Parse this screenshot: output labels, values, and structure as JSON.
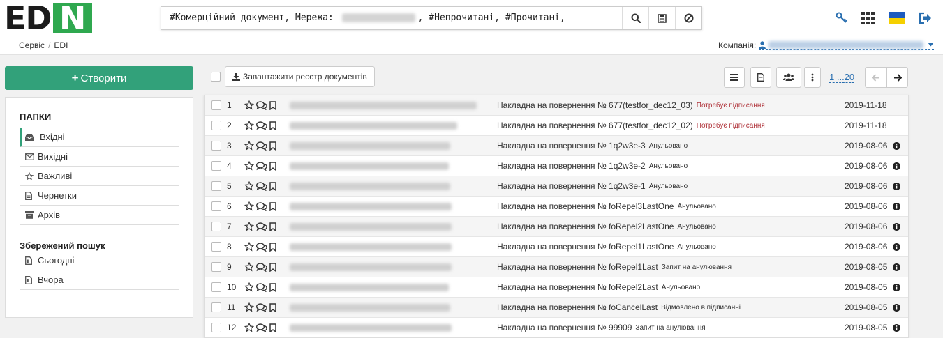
{
  "logo": {
    "part1": "ED",
    "part2": "N"
  },
  "search": {
    "prefix": "#Комерційний документ, Мережа:",
    "suffix": ", #Непрочитані, #Прочитані,",
    "buttons": [
      "search-icon",
      "save-icon",
      "ban-icon"
    ]
  },
  "header_icons": [
    "key-icon",
    "apps-grid-icon",
    "ukraine-flag-icon",
    "logout-icon"
  ],
  "breadcrumb": {
    "items": [
      "Сервіс",
      "EDI"
    ],
    "separator": "/"
  },
  "company": {
    "label": "Компанія:"
  },
  "sidebar": {
    "create_label": "Створити",
    "create_plus": "+",
    "folders_title": "ПАПКИ",
    "folders": [
      {
        "label": "Вхідні",
        "icon": "inbox-icon",
        "active": true
      },
      {
        "label": "Вихідні",
        "icon": "envelope-icon",
        "active": false
      },
      {
        "label": "Важливі",
        "icon": "star-icon",
        "active": false
      },
      {
        "label": "Чернетки",
        "icon": "draft-icon",
        "active": false
      },
      {
        "label": "Архів",
        "icon": "archive-icon",
        "active": false
      }
    ],
    "saved_title": "Збережений пошук",
    "saved": [
      {
        "label": "Сьогодні",
        "icon": "saved-search-icon"
      },
      {
        "label": "Вчора",
        "icon": "saved-search-icon"
      }
    ]
  },
  "toolbar": {
    "upload_label": "Завантажити реєстр документів",
    "pager_text": "1 ...20"
  },
  "colors": {
    "brand_green": "#2fa84f",
    "accent_teal": "#32a17a",
    "link_blue": "#2a6fb0",
    "status_red": "#b0333a"
  },
  "documents": [
    {
      "num": "1",
      "title": "Накладна на повернення № 677(testfor_dec12_03)",
      "status": "Потребує підписання",
      "status_type": "warn",
      "date": "2019-11-18",
      "info": false
    },
    {
      "num": "2",
      "title": "Накладна на повернення № 677(testfor_dec12_02)",
      "status": "Потребує підписання",
      "status_type": "warn",
      "date": "2019-11-18",
      "info": false
    },
    {
      "num": "3",
      "title": "Накладна на повернення № 1q2w3e-3",
      "status": "Анульовано",
      "status_type": "normal",
      "date": "2019-08-06",
      "info": true
    },
    {
      "num": "4",
      "title": "Накладна на повернення № 1q2w3e-2",
      "status": "Анульовано",
      "status_type": "normal",
      "date": "2019-08-06",
      "info": true
    },
    {
      "num": "5",
      "title": "Накладна на повернення № 1q2w3e-1",
      "status": "Анульовано",
      "status_type": "normal",
      "date": "2019-08-06",
      "info": true
    },
    {
      "num": "6",
      "title": "Накладна на повернення № foRepel3LastOne",
      "status": "Анульовано",
      "status_type": "normal",
      "date": "2019-08-06",
      "info": true
    },
    {
      "num": "7",
      "title": "Накладна на повернення № foRepel2LastOne",
      "status": "Анульовано",
      "status_type": "normal",
      "date": "2019-08-06",
      "info": true
    },
    {
      "num": "8",
      "title": "Накладна на повернення № foRepel1LastOne",
      "status": "Анульовано",
      "status_type": "normal",
      "date": "2019-08-06",
      "info": true
    },
    {
      "num": "9",
      "title": "Накладна на повернення № foRepel1Last",
      "status": "Запит на анулювання",
      "status_type": "normal",
      "date": "2019-08-05",
      "info": true
    },
    {
      "num": "10",
      "title": "Накладна на повернення № foRepel2Last",
      "status": "Анульовано",
      "status_type": "normal",
      "date": "2019-08-05",
      "info": true
    },
    {
      "num": "11",
      "title": "Накладна на повернення № foCancelLast",
      "status": "Відмовлено в підписанні",
      "status_type": "normal",
      "date": "2019-08-05",
      "info": true
    },
    {
      "num": "12",
      "title": "Накладна на повернення № 99909",
      "status": "Запит на анулювання",
      "status_type": "normal",
      "date": "2019-08-05",
      "info": true
    }
  ]
}
